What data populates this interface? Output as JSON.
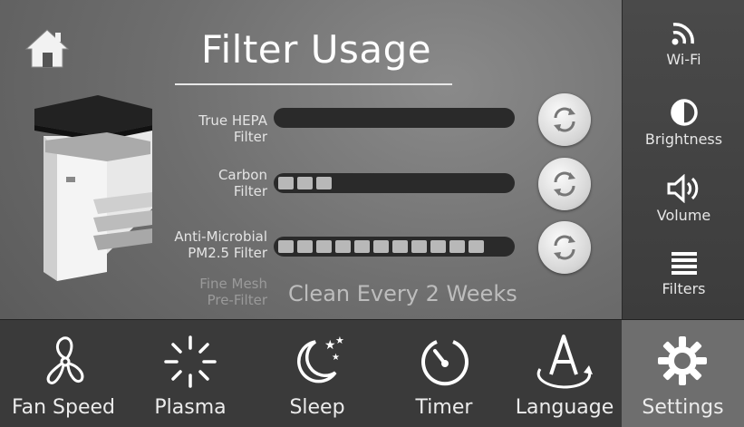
{
  "header": {
    "title": "Filter Usage"
  },
  "filters": [
    {
      "label_line1": "True HEPA",
      "label_line2": "Filter",
      "usage_segments": 0
    },
    {
      "label_line1": "Carbon",
      "label_line2": "Filter",
      "usage_segments": 3
    },
    {
      "label_line1": "Anti-Microbial",
      "label_line2": "PM2.5 Filter",
      "usage_segments": 11
    },
    {
      "label_line1": "Fine Mesh",
      "label_line2": "Pre-Filter",
      "note": "Clean Every 2 Weeks"
    }
  ],
  "sidebar": {
    "items": [
      {
        "label": "Wi-Fi",
        "icon": "wifi-icon"
      },
      {
        "label": "Brightness",
        "icon": "brightness-icon"
      },
      {
        "label": "Volume",
        "icon": "volume-icon"
      },
      {
        "label": "Filters",
        "icon": "filters-icon"
      }
    ]
  },
  "bottom_nav": {
    "items": [
      {
        "label": "Fan Speed",
        "icon": "fan-icon"
      },
      {
        "label": "Plasma",
        "icon": "plasma-icon"
      },
      {
        "label": "Sleep",
        "icon": "sleep-icon"
      },
      {
        "label": "Timer",
        "icon": "timer-icon"
      },
      {
        "label": "Language",
        "icon": "language-icon"
      },
      {
        "label": "Settings",
        "icon": "gear-icon",
        "active": true
      }
    ]
  }
}
